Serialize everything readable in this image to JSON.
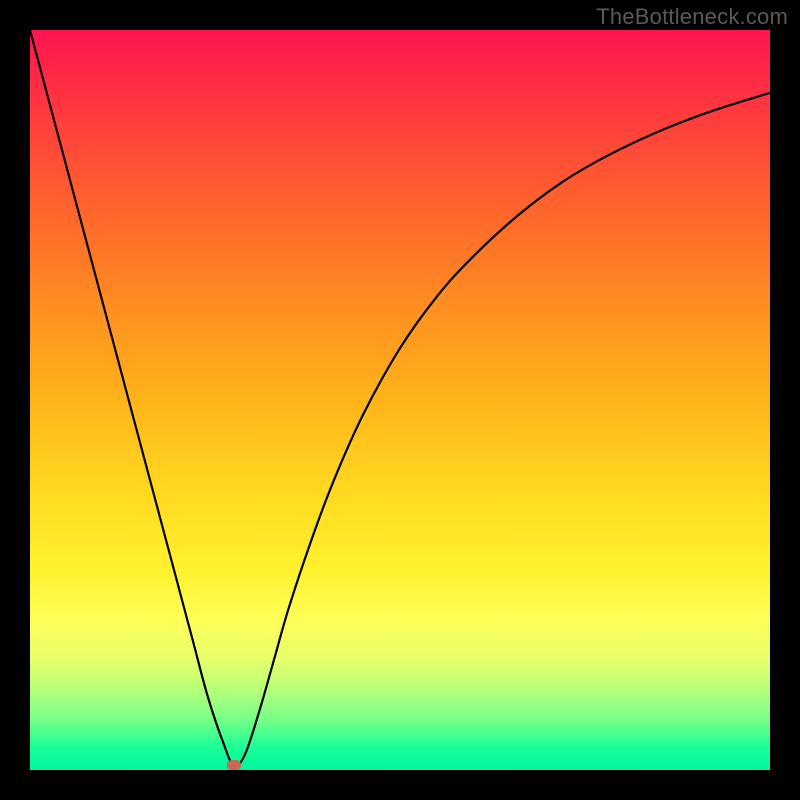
{
  "watermark": "TheBottleneck.com",
  "chart_data": {
    "type": "line",
    "title": "",
    "xlabel": "",
    "ylabel": "",
    "xlim": [
      0,
      100
    ],
    "ylim": [
      0,
      100
    ],
    "grid": false,
    "legend": false,
    "background_gradient": {
      "top_color": "#ff1450",
      "bottom_color": "#00f7a0",
      "description": "vertical red-to-green gradient"
    },
    "series": [
      {
        "name": "curve",
        "color": "#000000",
        "x": [
          0,
          2,
          4,
          6,
          8,
          10,
          12,
          14,
          16,
          18,
          20,
          22,
          24,
          26,
          27.5,
          29,
          31,
          33,
          35,
          38,
          41,
          45,
          50,
          55,
          60,
          66,
          72,
          78,
          85,
          92,
          100
        ],
        "values": [
          100,
          92.5,
          85,
          77.5,
          70,
          62.5,
          55,
          47.5,
          40,
          32.5,
          25,
          17.5,
          10,
          4,
          0.7,
          2,
          8,
          15,
          22,
          31,
          39,
          48,
          57,
          64,
          69.5,
          75,
          79.5,
          83,
          86.3,
          89,
          91.5
        ]
      }
    ],
    "marker": {
      "x": 27.5,
      "y": 0.7,
      "color": "#c86a52"
    }
  }
}
